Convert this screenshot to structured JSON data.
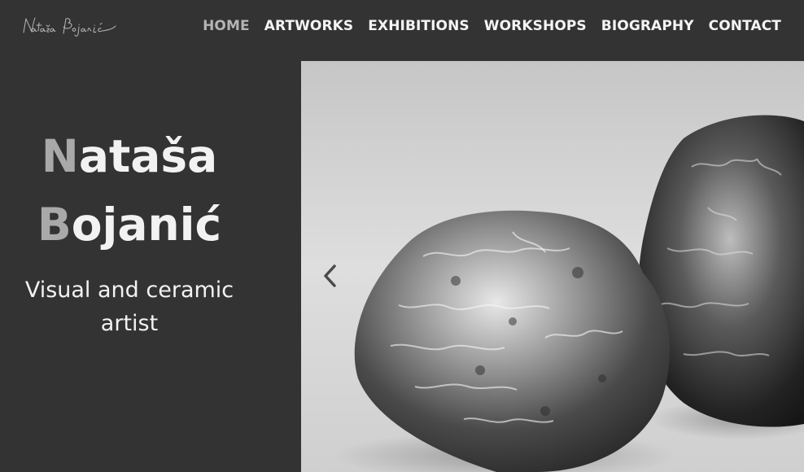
{
  "header": {
    "logo_alt": "Nataša Bojanić signature logo",
    "nav": [
      {
        "label": "HOME",
        "active": true
      },
      {
        "label": "ARTWORKS",
        "active": false
      },
      {
        "label": "EXHIBITIONS",
        "active": false
      },
      {
        "label": "WORKSHOPS",
        "active": false
      },
      {
        "label": "BIOGRAPHY",
        "active": false
      },
      {
        "label": "CONTACT",
        "active": false
      }
    ]
  },
  "hero": {
    "first_initial": "N",
    "first_rest": "ataša",
    "last_initial": "B",
    "last_rest": "ojanić",
    "subtitle": "Visual and ceramic artist"
  },
  "slideshow": {
    "prev_icon": "chevron-left-icon",
    "image_subject": "metallic ceramic sculptures"
  },
  "colors": {
    "background": "#333333",
    "text": "#f2f2f2",
    "accent_gray": "#a9a9a9",
    "nav_active": "#b4b4b4"
  }
}
